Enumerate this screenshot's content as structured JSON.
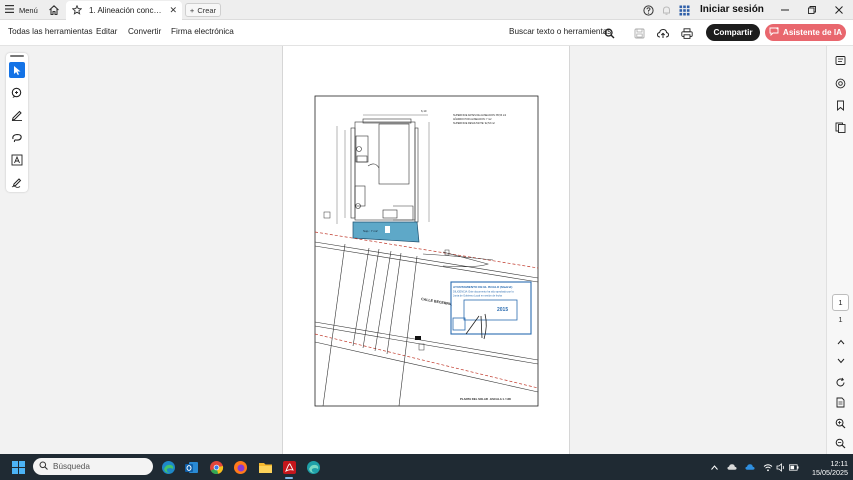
{
  "tabbar": {
    "menu_label": "Menú",
    "tab_title": "1. Alineación concesi...",
    "new_tab_label": "Crear",
    "signin_label": "Iniciar sesión"
  },
  "toolbar": {
    "menus": [
      "Todas las herramientas",
      "Editar",
      "Convertir",
      "Firma electrónica"
    ],
    "search_label": "Buscar texto o herramientas",
    "share_label": "Compartir",
    "ai_label": "Asistente de IA"
  },
  "document": {
    "stamp_line1": "AYUNTAMIENTO DE EL BOALO (Madrid)",
    "stamp_line2": "DILIGENCIA: Este documento ha sido aprobado por la",
    "stamp_line3": "Junta de Gobierno Local en sesión de fecha",
    "stamp_year": "2015",
    "street_label": "CALLE BECERRIL",
    "footer_label": "PLANTA DEL SOLAR . ESCALA 1 / 100",
    "legend_line1": "SUPERFICIE ANTES DE ALINEACION: 85,53 m2",
    "legend_line2": "AÑADIDO POR ALINEACION: 7 m2",
    "legend_line3": "SUPERFICIE RESULTANTE: 92,53 m2",
    "dim_top": "6,10",
    "shaded_label": "Sup.: 7 m2"
  },
  "pagination": {
    "current_page": "1",
    "total_pages": "1"
  },
  "taskbar": {
    "search_placeholder": "Búsqueda",
    "time": "12:11",
    "date": "15/05/2025"
  },
  "colors": {
    "accent_blue": "#1473e6",
    "ai_button": "#e9676e",
    "stamp_blue": "#2b6cb0",
    "shaded_area": "#5ea8c8",
    "dashed_red": "#c0392b",
    "taskbar": "#1f2a33"
  }
}
